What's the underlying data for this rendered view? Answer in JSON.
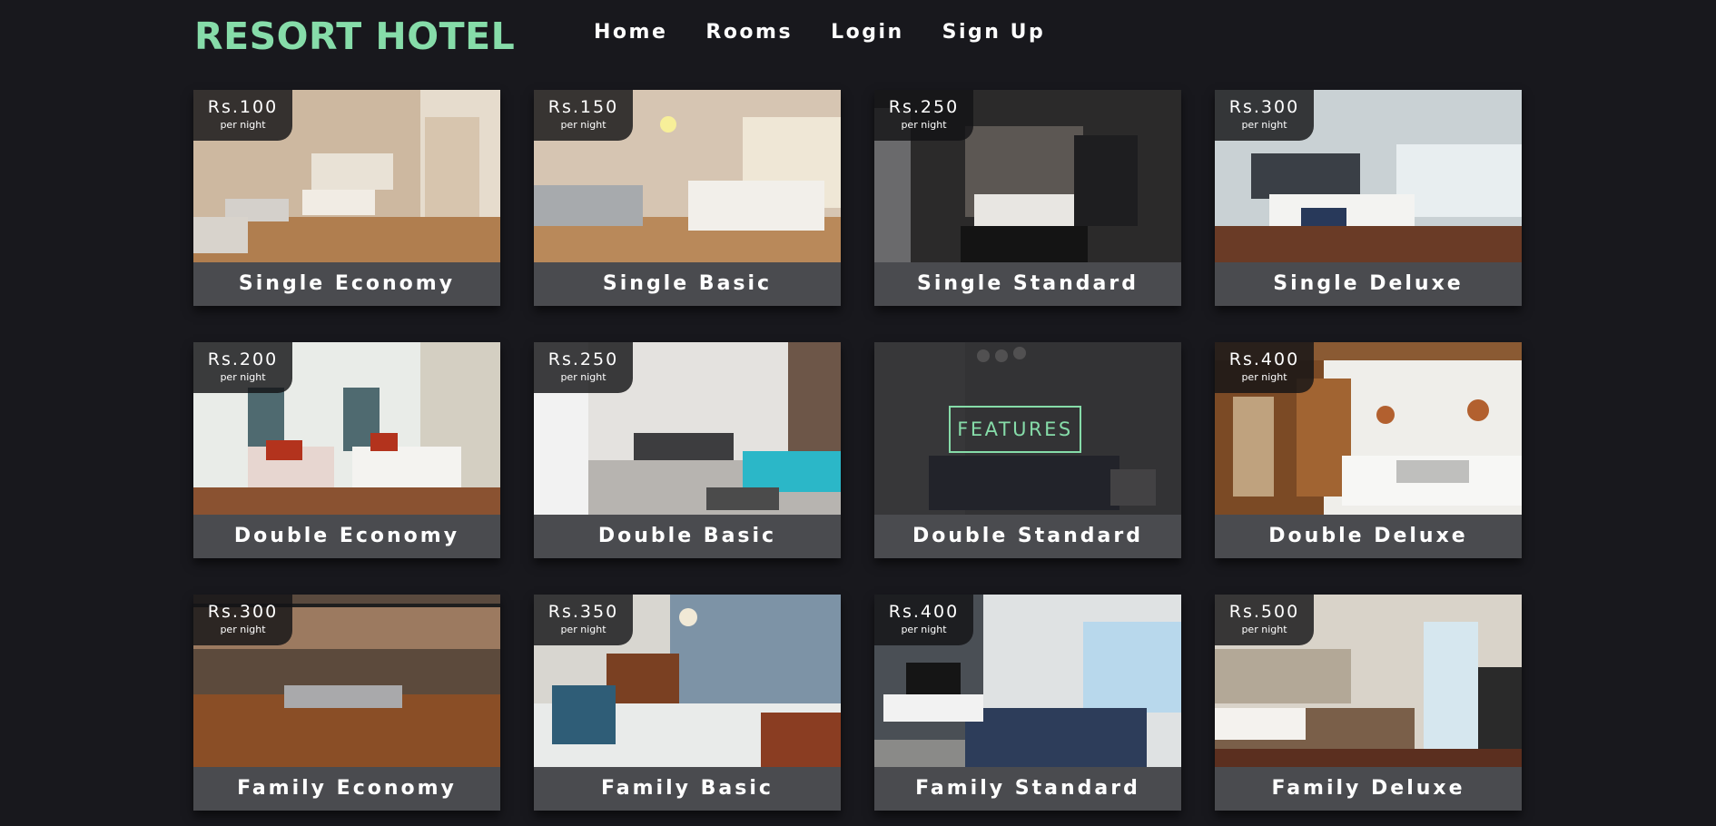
{
  "header": {
    "logo": "RESORT HOTEL",
    "nav": [
      "Home",
      "Rooms",
      "Login",
      "Sign Up"
    ]
  },
  "rooms": [
    {
      "name": "Single Economy",
      "price": "Rs.100",
      "per": "per night"
    },
    {
      "name": "Single Basic",
      "price": "Rs.150",
      "per": "per night"
    },
    {
      "name": "Single Standard",
      "price": "Rs.250",
      "per": "per night"
    },
    {
      "name": "Single Deluxe",
      "price": "Rs.300",
      "per": "per night"
    },
    {
      "name": "Double Economy",
      "price": "Rs.200",
      "per": "per night"
    },
    {
      "name": "Double Basic",
      "price": "Rs.250",
      "per": "per night"
    },
    {
      "name": "Double Standard",
      "price": "",
      "per": "",
      "features": "FEATURES"
    },
    {
      "name": "Double Deluxe",
      "price": "Rs.400",
      "per": "per night"
    },
    {
      "name": "Family Economy",
      "price": "Rs.300",
      "per": "per night"
    },
    {
      "name": "Family Basic",
      "price": "Rs.350",
      "per": "per night"
    },
    {
      "name": "Family Standard",
      "price": "Rs.400",
      "per": "per night"
    },
    {
      "name": "Family Deluxe",
      "price": "Rs.500",
      "per": "per night"
    }
  ],
  "colors": {
    "accent": "#86dca9",
    "background": "#18181d",
    "card_label": "#4a4b4f"
  }
}
